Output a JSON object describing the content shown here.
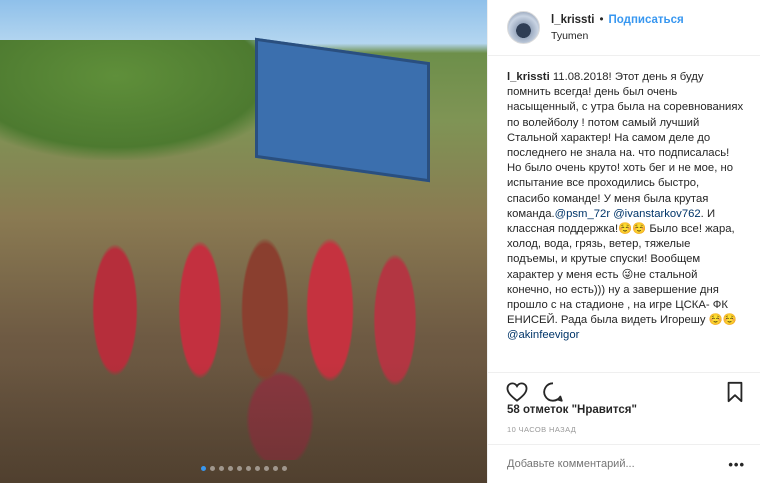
{
  "post": {
    "username": "l_krissti",
    "separator": "•",
    "follow_label": "Подписаться",
    "location": "Tyumen"
  },
  "caption": {
    "username": "l_krissti",
    "part1": " 11.08.2018! Этот день я буду помнить всегда! день был очень насыщенный, с утра была на соревнованиях по волейболу ! потом самый лучший Стальной характер! На самом деле до последнего не знала на. что подписалась! Но было очень круто! хоть бег и не мое, но испытание все проходились быстро, спасибо команде! У меня была крутая команда.",
    "mention1": "@psm_72r",
    "part2": " ",
    "mention2": "@ivanstarkov762",
    "part3": ". И классная поддержка!☺️☺️ Было все! жара, холод, вода, грязь, ветер, тяжелые подъемы, и крутые спуски! Вообщем характер у меня есть 😜не стальной конечно, но есть))) ну а завершение дня прошло с на стадионе , на игре ЦСКА- ФК ЕНИСЕЙ. Рада была видеть Игорешу ☺️☺️",
    "mention3": "@akinfeevigor"
  },
  "actions": {
    "like_icon": "heart-icon",
    "comment_icon": "comment-icon",
    "save_icon": "bookmark-icon"
  },
  "likes_text": "58 отметок \"Нравится\"",
  "time_text": "10 часов назад",
  "comment": {
    "placeholder": "Добавьте комментарий...",
    "more_label": "•••"
  },
  "carousel": {
    "count": 10,
    "active_index": 0
  },
  "colors": {
    "accent": "#3897f0",
    "text": "#262626",
    "muted": "#999999",
    "border": "#efefef"
  }
}
